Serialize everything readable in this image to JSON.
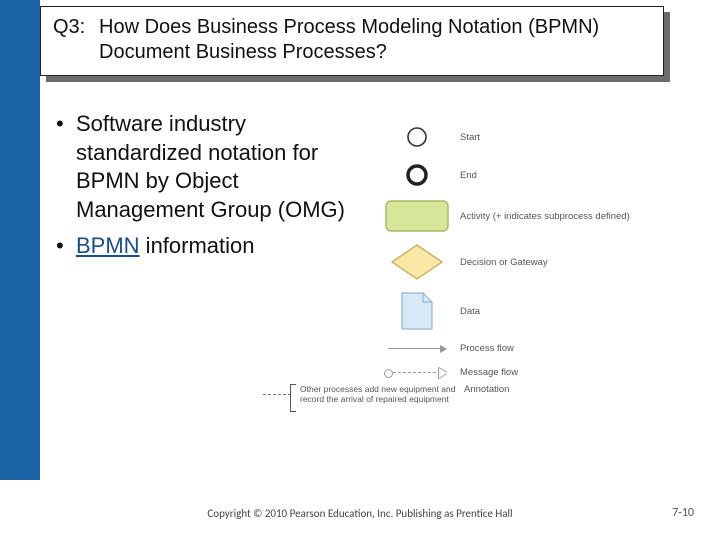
{
  "title": {
    "prefix": "Q3:",
    "text": "How Does Business Process Modeling Notation (BPMN) Document Business Processes?"
  },
  "bullets": {
    "b1": "Software industry standardized notation for BPMN by Object Management Group (OMG)",
    "b2_link": "BPMN",
    "b2_rest": " information"
  },
  "legend": {
    "start": "Start",
    "end": "End",
    "activity": "Activity (+ indicates subprocess defined)",
    "decision": "Decision or Gateway",
    "data": "Data",
    "process_flow": "Process flow",
    "message_flow": "Message flow",
    "annotation": "Annotation",
    "annotation_sample": "Other processes add new equipment and record the arrival of repaired equipment"
  },
  "footer": "Copyright © 2010 Pearson Education, Inc. Publishing as Prentice Hall",
  "pagenum": "7-10"
}
